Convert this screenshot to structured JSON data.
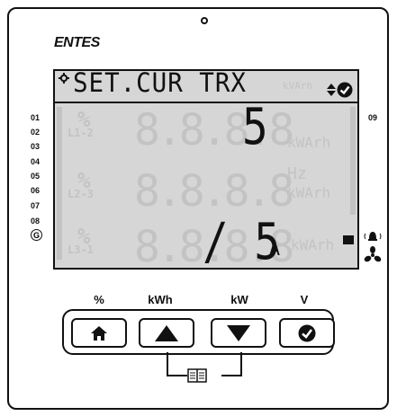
{
  "brand": "ENTES",
  "lcd": {
    "top_text": "SET.CUR TRX",
    "row1_value": "5",
    "row3_value": "/ 5",
    "unit": "A",
    "ghost_units": {
      "kvarh": "kVArh",
      "kwarh_1": "kWArh",
      "kwarh_2": "kWArh",
      "kwarh_3": "kWArh",
      "hz": "Hz",
      "pct_1": "%",
      "pct_2": "%",
      "pct_3": "%",
      "l12": "L1-2",
      "l23": "L2-3",
      "l31": "L3-1"
    },
    "ghost_digits": "8.8.8.8"
  },
  "left_indicators": [
    "01",
    "02",
    "03",
    "04",
    "05",
    "06",
    "07",
    "08"
  ],
  "g_indicator": "G",
  "right_indicator": "09",
  "keys": [
    {
      "label": "%",
      "icon": "home-icon"
    },
    {
      "label": "kWh",
      "icon": "triangle-up-icon"
    },
    {
      "label": "kW",
      "icon": "triangle-down-icon"
    },
    {
      "label": "V",
      "icon": "check-circle-icon"
    }
  ]
}
